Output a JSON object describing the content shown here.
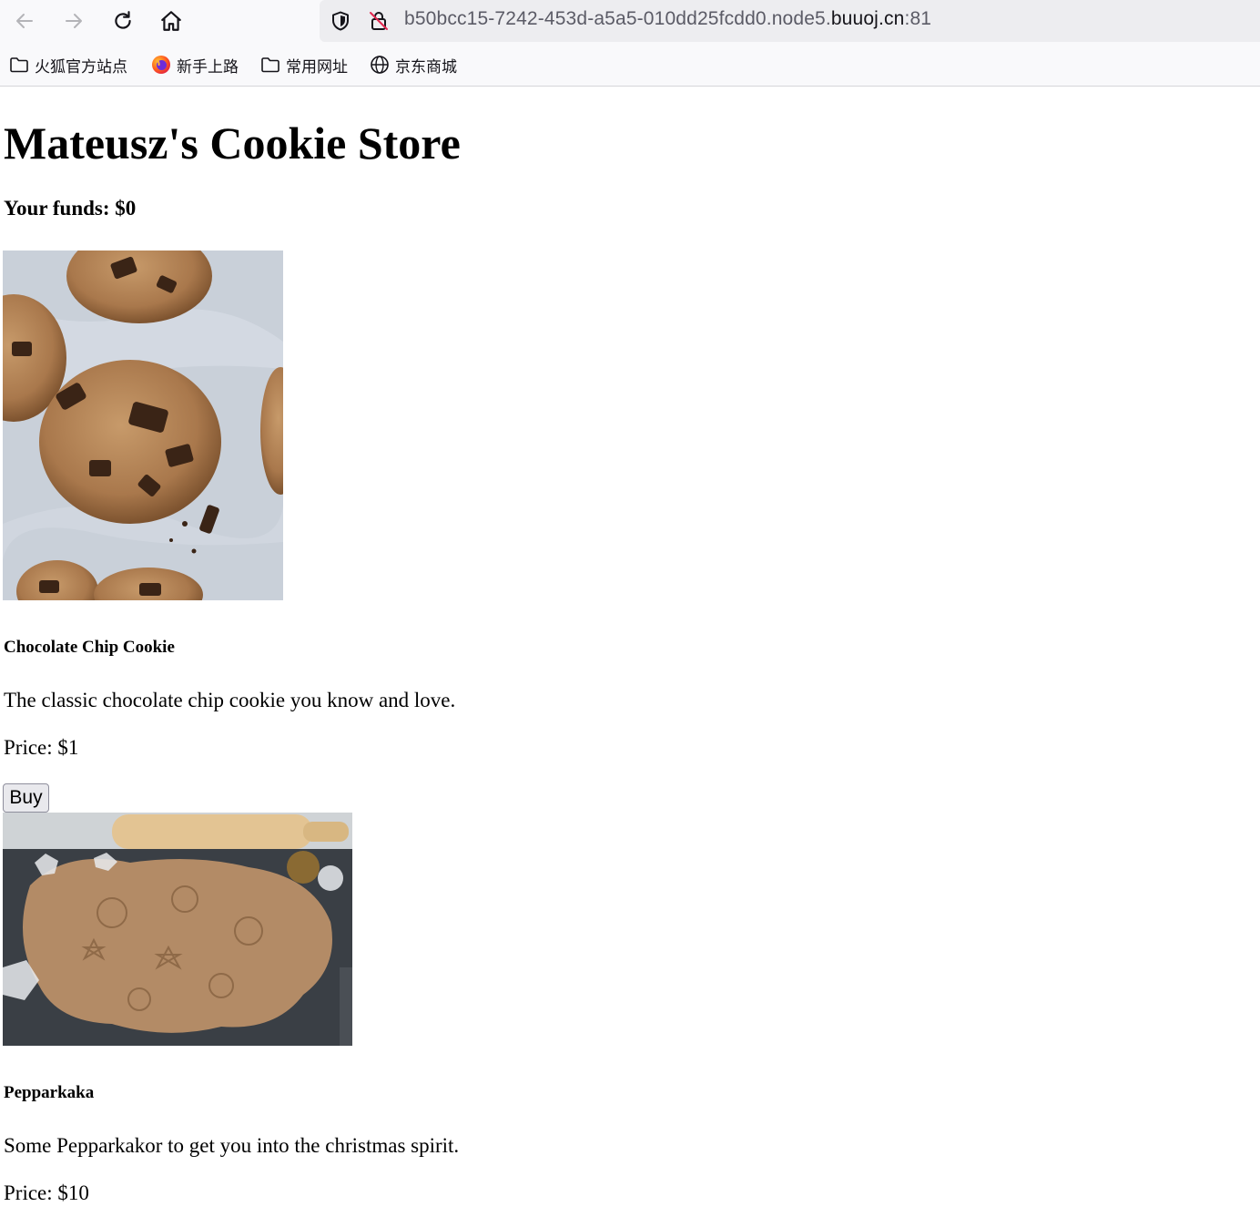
{
  "browser": {
    "url_prefix": "b50bcc15-7242-453d-a5a5-010dd25fcdd0.node5.",
    "url_domain": "buuoj.cn",
    "url_port": ":81",
    "bookmarks": [
      {
        "label": "火狐官方站点",
        "icon": "folder-icon"
      },
      {
        "label": "新手上路",
        "icon": "firefox-icon"
      },
      {
        "label": "常用网址",
        "icon": "folder-icon"
      },
      {
        "label": "京东商城",
        "icon": "globe-icon"
      }
    ]
  },
  "page": {
    "title": "Mateusz's Cookie Store",
    "funds": "Your funds: $0",
    "products": [
      {
        "name": "Chocolate Chip Cookie",
        "description": "The classic chocolate chip cookie you know and love.",
        "price": "Price: $1",
        "buy_label": "Buy",
        "image": "chocolate-chip-cookies-photo"
      },
      {
        "name": "Pepparkaka",
        "description": "Some Pepparkakor to get you into the christmas spirit.",
        "price": "Price: $10",
        "image": "gingerbread-dough-photo"
      }
    ]
  }
}
